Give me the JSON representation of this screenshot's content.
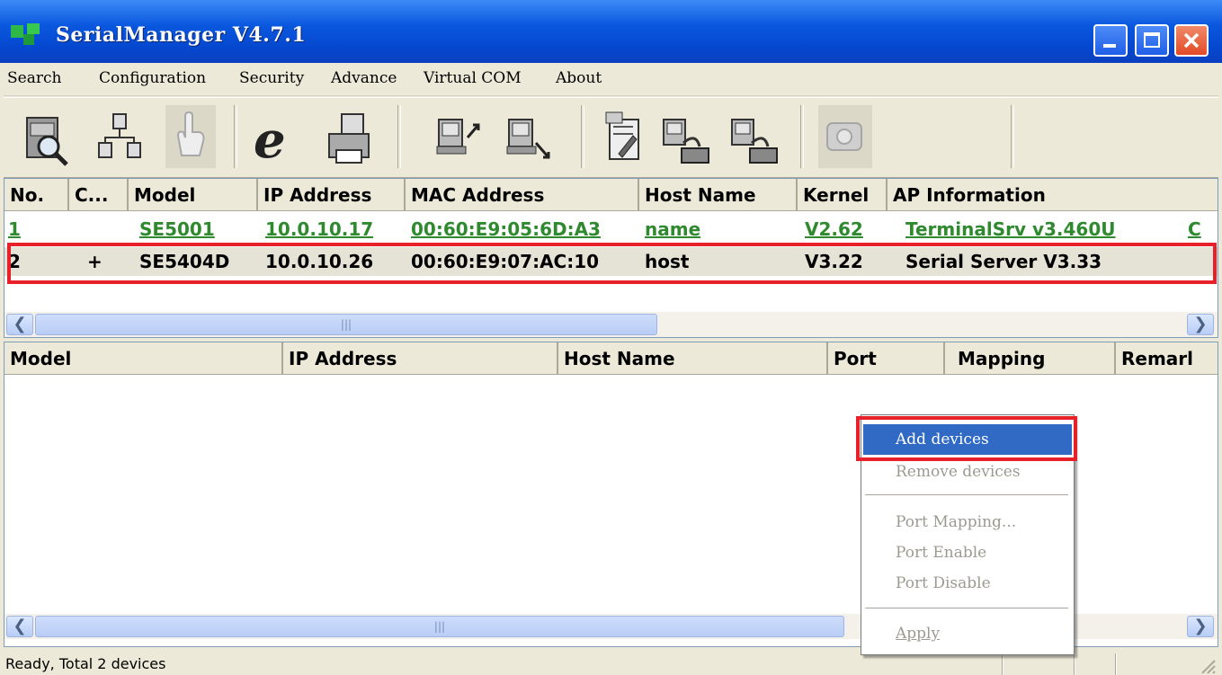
{
  "window": {
    "title": "SerialManager V4.7.1"
  },
  "menu": [
    "Search",
    "Configuration",
    "Security",
    "Advance",
    "Virtual COM",
    "About"
  ],
  "toolbar": {
    "tools": [
      "search-device-icon",
      "network-icon",
      "hand-icon",
      "internet-explorer-icon",
      "printer-icon",
      "upload-icon",
      "download-icon",
      "edit-config-icon",
      "com-mapping-icon",
      "com-mapping-2-icon",
      "phone-icon"
    ]
  },
  "device_list": {
    "headers": [
      "No.",
      "C...",
      "Model",
      "IP Address",
      "MAC Address",
      "Host Name",
      "Kernel",
      "AP Information"
    ],
    "rows": [
      {
        "no": "1",
        "c": "",
        "model": "SE5001",
        "ip": "10.0.10.17",
        "mac": "00:60:E9:05:6D:A3",
        "host": "name",
        "kernel": "V2.62",
        "ap": "TerminalSrv v3.460U",
        "extra": "C"
      },
      {
        "no": "2",
        "c": "+",
        "model": "SE5404D",
        "ip": "10.0.10.26",
        "mac": "00:60:E9:07:AC:10",
        "host": "host",
        "kernel": "V3.22",
        "ap": "Serial Server V3.33",
        "extra": ""
      }
    ]
  },
  "mapping_list": {
    "headers": [
      "Model",
      "IP Address",
      "Host Name",
      "Port",
      "Mapping",
      "Remarl"
    ]
  },
  "context_menu": {
    "items": [
      "Add devices",
      "Remove devices",
      "Port Mapping...",
      "Port Enable",
      "Port Disable",
      "Apply"
    ]
  },
  "status": {
    "text": "Ready, Total 2 devices"
  },
  "colors": {
    "highlight": "#e8202a",
    "selection": "#316ac5",
    "green_row": "#2f8a2f"
  }
}
